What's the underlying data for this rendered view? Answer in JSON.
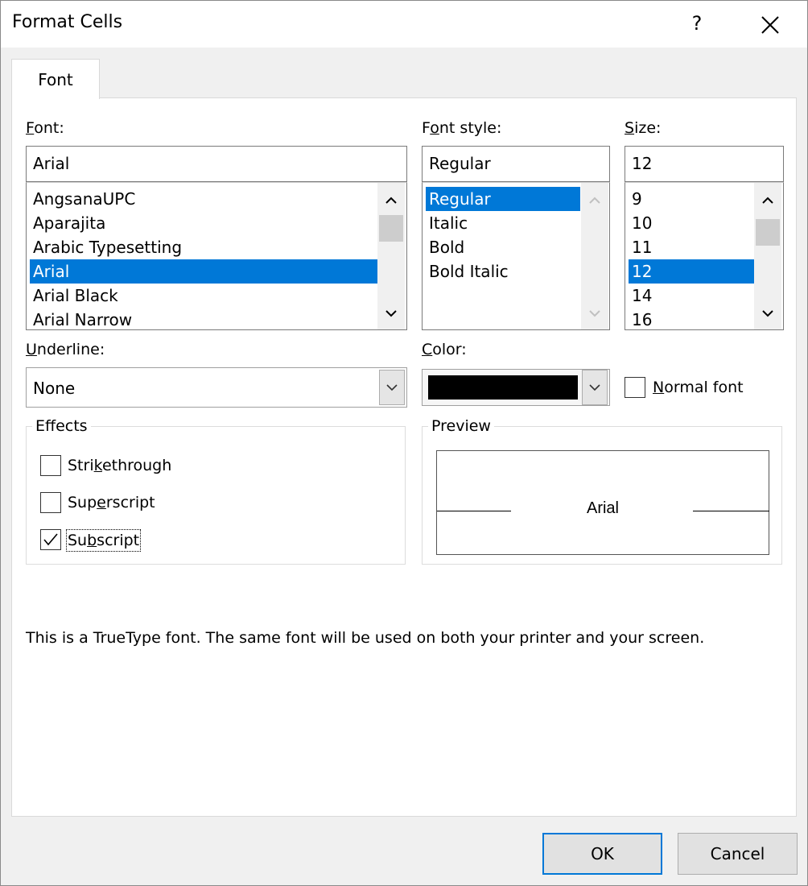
{
  "window": {
    "title": "Format Cells",
    "help_label": "?",
    "close_icon": "close-icon"
  },
  "tabs": [
    {
      "label": "Font",
      "active": true
    }
  ],
  "font": {
    "label_prefix": "",
    "label_mnemonic": "F",
    "label_rest": "ont:",
    "value": "Arial",
    "items": [
      "AngsanaUPC",
      "Aparajita",
      "Arabic Typesetting",
      "Arial",
      "Arial Black",
      "Arial Narrow"
    ],
    "selected": "Arial"
  },
  "font_style": {
    "label_prefix": "F",
    "label_mnemonic": "o",
    "label_rest": "nt style:",
    "value": "Regular",
    "items": [
      "Regular",
      "Italic",
      "Bold",
      "Bold Italic"
    ],
    "selected": "Regular"
  },
  "size": {
    "label_prefix": "",
    "label_mnemonic": "S",
    "label_rest": "ize:",
    "value": "12",
    "items": [
      "9",
      "10",
      "11",
      "12",
      "14",
      "16"
    ],
    "selected": "12"
  },
  "underline": {
    "label_prefix": "",
    "label_mnemonic": "U",
    "label_rest": "nderline:",
    "value": "None"
  },
  "color": {
    "label_prefix": "",
    "label_mnemonic": "C",
    "label_rest": "olor:",
    "swatch": "#000000"
  },
  "normal_font": {
    "label_prefix": "",
    "label_mnemonic": "N",
    "label_rest": "ormal font",
    "checked": false
  },
  "effects": {
    "title": "Effects",
    "strikethrough": {
      "prefix": "Stri",
      "mnemonic": "k",
      "rest": "ethrough",
      "checked": false
    },
    "superscript": {
      "prefix": "Sup",
      "mnemonic": "e",
      "rest": "rscript",
      "checked": false
    },
    "subscript": {
      "prefix": "Su",
      "mnemonic": "b",
      "rest": "script",
      "checked": true
    }
  },
  "preview": {
    "title": "Preview",
    "sample": "Arial"
  },
  "info_text": "This is a TrueType font.  The same font will be used on both your printer and your screen.",
  "buttons": {
    "ok": "OK",
    "cancel": "Cancel"
  },
  "colors": {
    "selection": "#0078d7",
    "panel": "#ffffff",
    "background": "#f0f0f0"
  }
}
